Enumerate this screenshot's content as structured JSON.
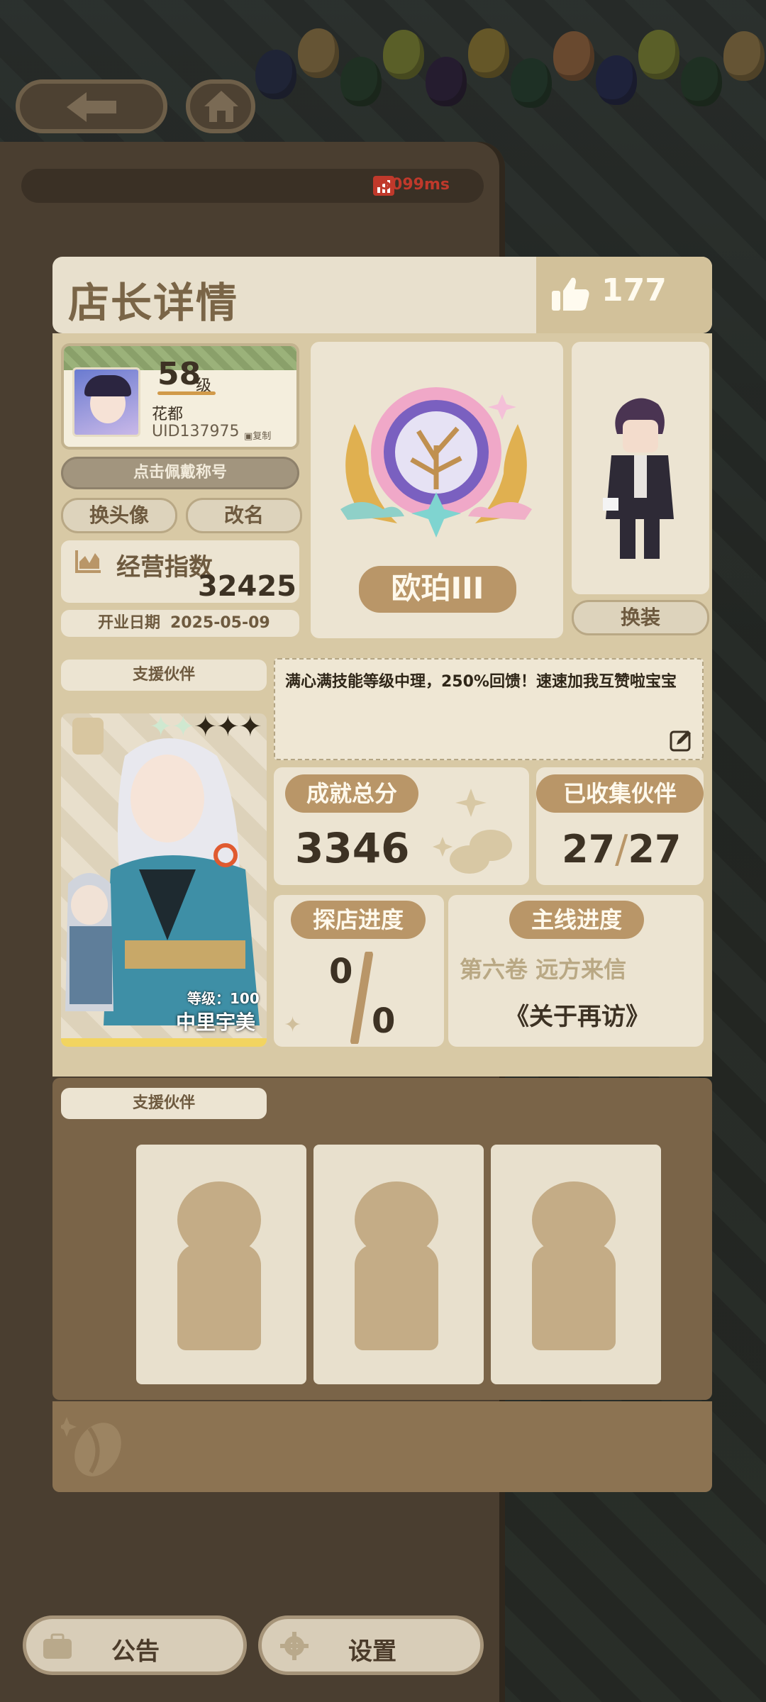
{
  "network": {
    "latency": "5099ms",
    "color": "#c0392b"
  },
  "header": {
    "title": "店长详情",
    "likes": "177"
  },
  "profile": {
    "level": "58",
    "level_unit": "级",
    "name": "花都",
    "uid": "UID137975",
    "copy_label": "复制",
    "wear_title_label": "点击佩戴称号",
    "change_avatar_label": "换头像",
    "rename_label": "改名",
    "business_index_label": "经营指数",
    "business_index_value": "32425",
    "open_date_label": "开业日期",
    "open_date_value": "2025-05-09"
  },
  "rank": {
    "label": "欧珀III"
  },
  "outfit": {
    "change_label": "换装"
  },
  "support_partner": {
    "section_label": "支援伙伴",
    "stars_filled": 2,
    "stars_total": 5,
    "level_text": "等级：100",
    "name": "中里宇美"
  },
  "signature": {
    "text": "满心满技能等级中理，250%回馈！速速加我互赞啦宝宝"
  },
  "stats": {
    "achievement_label": "成就总分",
    "achievement_value": "3346",
    "collected_label": "已收集伙伴",
    "collected_value": "27",
    "collected_total": "27",
    "explore_label": "探店进度",
    "explore_value": "0",
    "explore_total": "0",
    "main_label": "主线进度",
    "main_volume": "第六卷 远方来信",
    "main_chapter": "《关于再访》"
  },
  "support_partners_2": {
    "section_label": "支援伙伴",
    "slots": [
      "empty",
      "empty",
      "empty"
    ]
  },
  "bottom": {
    "notice_label": "公告",
    "settings_label": "设置"
  },
  "colors": {
    "panel": "#d8c9a5",
    "card": "#ece4d2",
    "accent_brown": "#b99668",
    "text_brown": "#6e5a3f"
  }
}
